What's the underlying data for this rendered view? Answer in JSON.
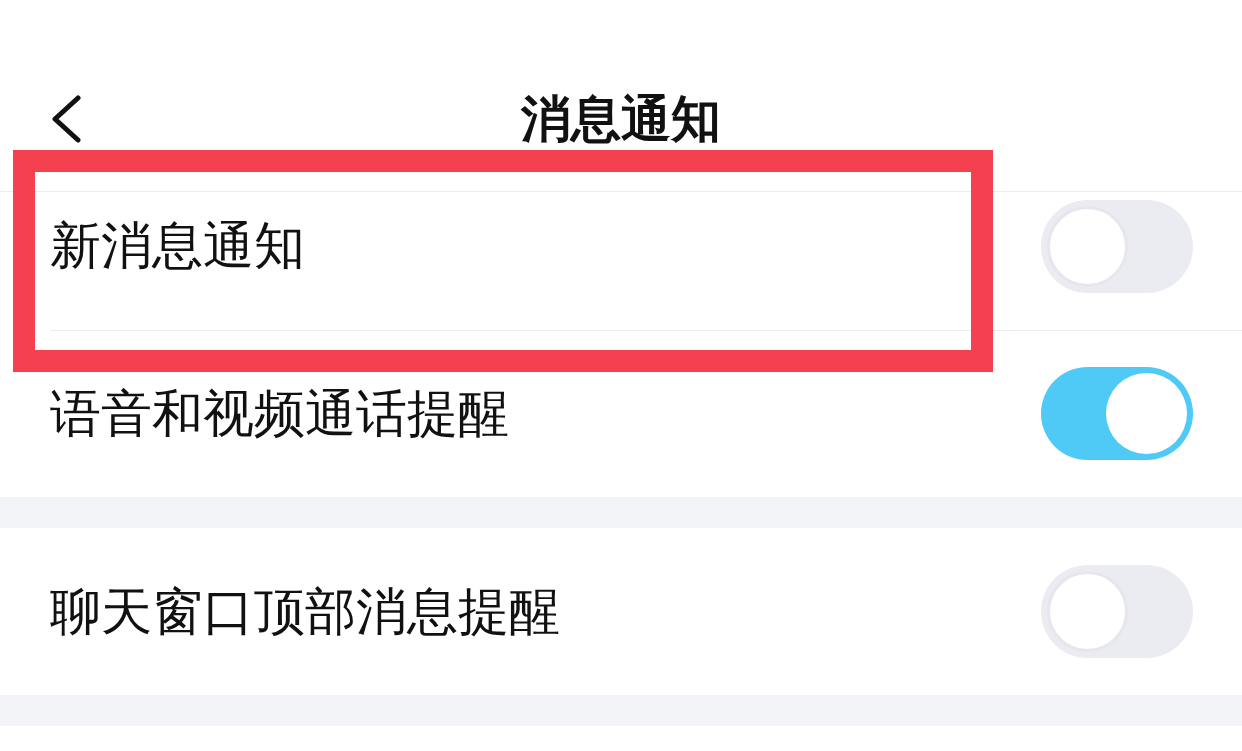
{
  "header": {
    "title": "消息通知"
  },
  "sections": [
    {
      "rows": [
        {
          "label": "新消息通知",
          "on": false,
          "highlighted": true
        },
        {
          "label": "语音和视频通话提醒",
          "on": true,
          "highlighted": false
        }
      ]
    },
    {
      "rows": [
        {
          "label": "聊天窗口顶部消息提醒",
          "on": false,
          "highlighted": false
        }
      ]
    }
  ]
}
